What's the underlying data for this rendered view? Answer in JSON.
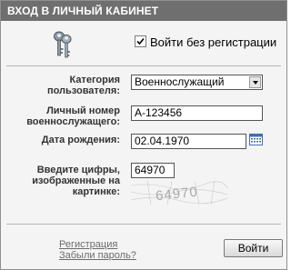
{
  "header": {
    "title": "ВХОД В ЛИЧНЫЙ КАБИНЕТ"
  },
  "guest": {
    "label": "Войти без регистрации",
    "checked": true
  },
  "form": {
    "category_label": "Категория пользователя:",
    "category_value": "Военнослужащий",
    "personal_number_label": "Личный номер военнослужащего:",
    "personal_number_value": "А-123456",
    "birth_date_label": "Дата рождения:",
    "birth_date_value": "02.04.1970",
    "captcha_label": "Введите цифры, изображенные на картинке:",
    "captcha_value": "64970",
    "captcha_image_text": "64970"
  },
  "footer": {
    "register_link": "Регистрация",
    "forgot_link": "Забыли пароль?",
    "login_button": "Войти"
  },
  "icons": {
    "keys": "keys-icon",
    "checkbox": "checkbox-checked-icon",
    "calendar": "calendar-icon",
    "dropdown": "chevron-down-icon"
  }
}
